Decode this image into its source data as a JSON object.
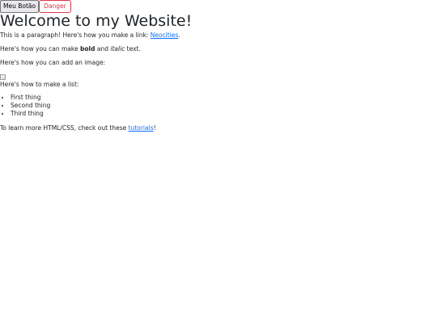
{
  "buttons": {
    "primary_label": "Meu Botão",
    "danger_label": "Danger"
  },
  "page": {
    "title": "Welcome to my Website!",
    "paragraph1_prefix": "This is a paragraph! Here's how you make a link: ",
    "link_neocities": "Neocities",
    "paragraph1_suffix": ".",
    "bold_prefix": "Here's how you can make ",
    "bold_word": "bold",
    "bold_mid": " and ",
    "italic_word": "italic",
    "bold_suffix": " text.",
    "image_text": "Here's how you can add an image:",
    "list_intro": "Here's how to make a list:",
    "list_items": [
      "First thing",
      "Second thing",
      "Third thing"
    ],
    "tutorial_prefix": "To learn more HTML/CSS, check out these ",
    "tutorial_link": "tutorials",
    "tutorial_suffix": "!"
  },
  "colors": {
    "text": "#212529",
    "link": "#0d6efd",
    "danger": "#dc3545"
  }
}
